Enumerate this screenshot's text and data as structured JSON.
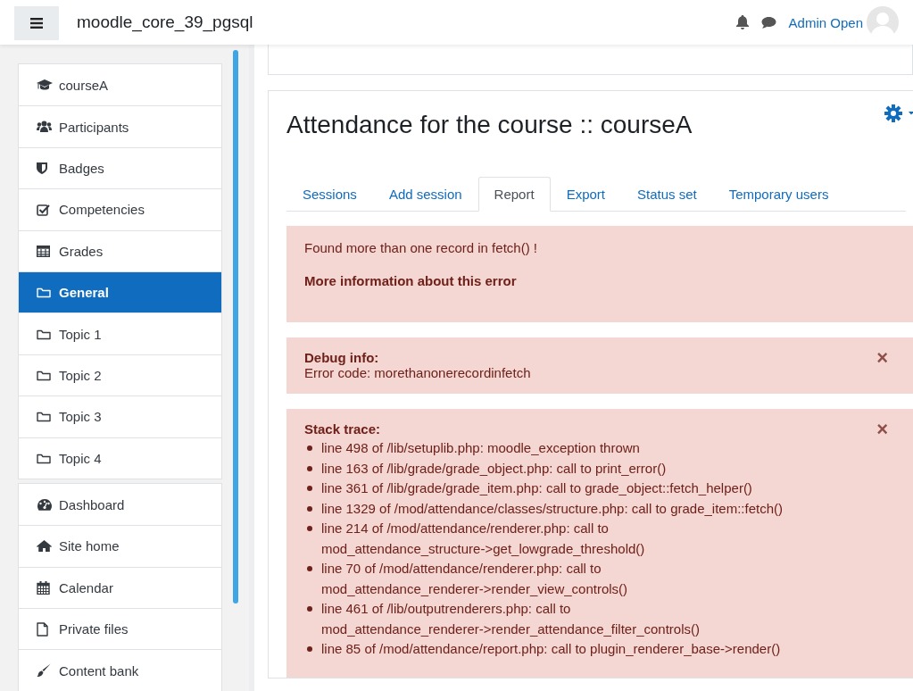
{
  "header": {
    "site_name": "moodle_core_39_pgsql",
    "user_name": "Admin Open"
  },
  "sidebar": {
    "groups": [
      {
        "items": [
          {
            "label": "courseA",
            "selected": false
          },
          {
            "label": "Participants",
            "selected": false
          },
          {
            "label": "Badges",
            "selected": false
          },
          {
            "label": "Competencies",
            "selected": false
          },
          {
            "label": "Grades",
            "selected": false
          },
          {
            "label": "General",
            "selected": true
          },
          {
            "label": "Topic 1",
            "selected": false
          },
          {
            "label": "Topic 2",
            "selected": false
          },
          {
            "label": "Topic 3",
            "selected": false
          },
          {
            "label": "Topic 4",
            "selected": false
          }
        ]
      },
      {
        "items": [
          {
            "label": "Dashboard",
            "selected": false
          },
          {
            "label": "Site home",
            "selected": false
          },
          {
            "label": "Calendar",
            "selected": false
          },
          {
            "label": "Private files",
            "selected": false
          },
          {
            "label": "Content bank",
            "selected": false
          }
        ]
      }
    ]
  },
  "page": {
    "title": "Attendance for the course :: courseA",
    "tabs": [
      {
        "label": "Sessions",
        "selected": false
      },
      {
        "label": "Add session",
        "selected": false
      },
      {
        "label": "Report",
        "selected": true
      },
      {
        "label": "Export",
        "selected": false
      },
      {
        "label": "Status set",
        "selected": false
      },
      {
        "label": "Temporary users",
        "selected": false
      }
    ],
    "error": {
      "message": "Found more than one record in fetch() !",
      "more_info": "More information about this error"
    },
    "debug": {
      "title": "Debug info:",
      "text": "Error code: morethanonerecordinfetch",
      "close": "×"
    },
    "stack": {
      "title": "Stack trace:",
      "close": "×",
      "lines": [
        "line 498 of /lib/setuplib.php: moodle_exception thrown",
        "line 163 of /lib/grade/grade_object.php: call to print_error()",
        "line 361 of /lib/grade/grade_item.php: call to grade_object::fetch_helper()",
        "line 1329 of /mod/attendance/classes/structure.php: call to grade_item::fetch()",
        "line 214 of /mod/attendance/renderer.php: call to mod_attendance_structure->get_lowgrade_threshold()",
        "line 70 of /mod/attendance/renderer.php: call to mod_attendance_renderer->render_view_controls()",
        "line 461 of /lib/outputrenderers.php: call to mod_attendance_renderer->render_attendance_filter_controls()",
        "line 85 of /mod/attendance/report.php: call to plugin_renderer_base->render()"
      ]
    }
  }
}
